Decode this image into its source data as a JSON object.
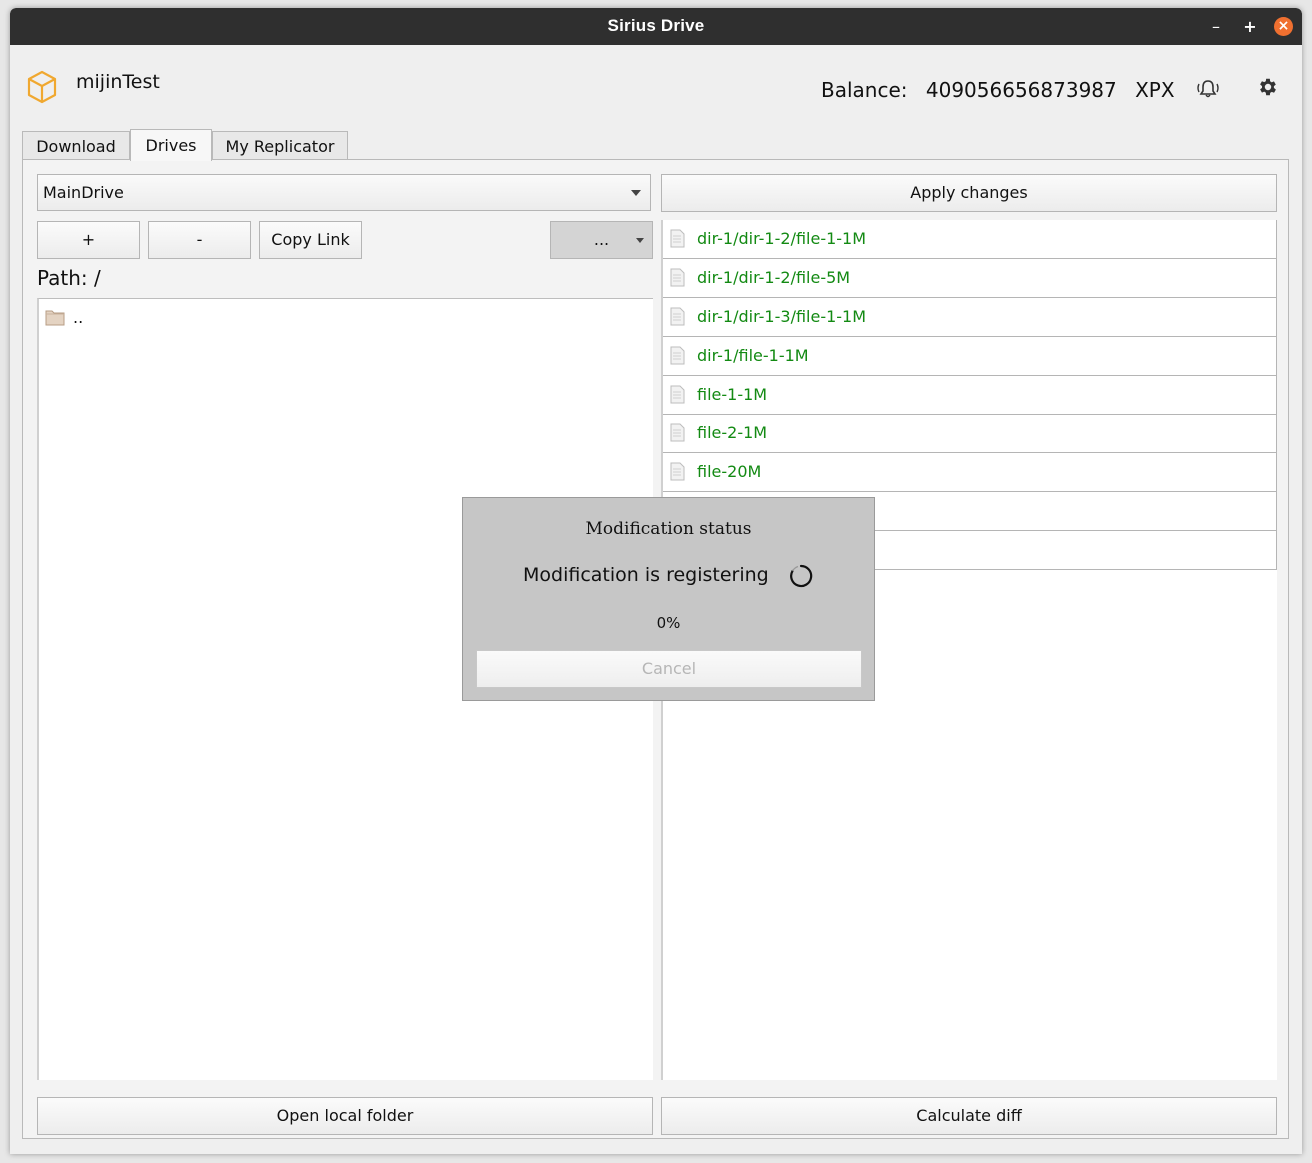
{
  "window": {
    "title": "Sirius Drive",
    "min_label": "–",
    "max_label": "+",
    "close_label": "×"
  },
  "header": {
    "username": "mijinTest",
    "balance_label": "Balance:",
    "balance_value": "409056656873987",
    "currency": "XPX"
  },
  "tabs": [
    {
      "label": "Download"
    },
    {
      "label": "Drives"
    },
    {
      "label": "My Replicator"
    }
  ],
  "drives": {
    "selected_drive": "MainDrive",
    "apply_label": "Apply changes",
    "add_label": "+",
    "remove_label": "-",
    "copy_link_label": "Copy Link",
    "more_label": "...",
    "path": "Path: /",
    "local_entries": [
      {
        "name": ".."
      }
    ],
    "diff_files": [
      {
        "name": "dir-1/dir-1-2/file-1-1M"
      },
      {
        "name": "dir-1/dir-1-2/file-5M"
      },
      {
        "name": "dir-1/dir-1-3/file-1-1M"
      },
      {
        "name": "dir-1/file-1-1M"
      },
      {
        "name": "file-1-1M"
      },
      {
        "name": "file-2-1M"
      },
      {
        "name": "file-20M"
      },
      {
        "name": ""
      },
      {
        "name": ""
      }
    ],
    "open_folder_label": "Open local folder",
    "calc_diff_label": "Calculate diff"
  },
  "modal": {
    "title": "Modification status",
    "message": "Modification is registering",
    "progress": "0%",
    "cancel_label": "Cancel"
  },
  "colors": {
    "titlebar": "#2f2f2f",
    "close_button": "#f07030",
    "file_text": "#138a13",
    "logo": "#f0a830"
  }
}
